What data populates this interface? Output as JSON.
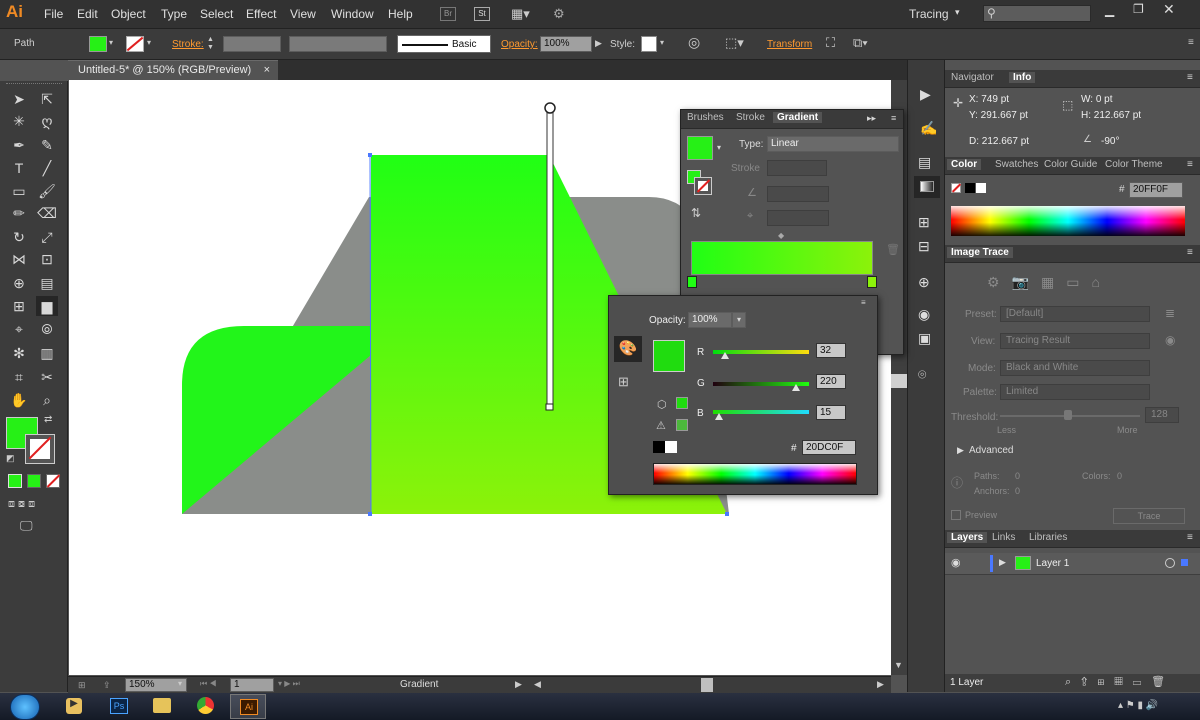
{
  "app": {
    "logo": "Ai"
  },
  "menu": [
    "File",
    "Edit",
    "Object",
    "Type",
    "Select",
    "Effect",
    "View",
    "Window",
    "Help"
  ],
  "menubar_right": {
    "br": "Br",
    "st": "St",
    "workspace": "Tracing",
    "search_placeholder": ""
  },
  "control": {
    "selection": "Path",
    "stroke_label": "Stroke:",
    "brush_label": "Basic",
    "opacity_label": "Opacity:",
    "opacity_value": "100%",
    "style_label": "Style:",
    "transform_label": "Transform"
  },
  "document": {
    "tab_title": "Untitled-5* @ 150% (RGB/Preview)",
    "close": "×"
  },
  "status": {
    "zoom": "150%",
    "page": "1",
    "info": "Gradient"
  },
  "navinfo": {
    "tabs": [
      "Navigator",
      "Info"
    ],
    "x": "X:  749 pt",
    "y": "Y:  291.667 pt",
    "w": "W:  0 pt",
    "h": "H:  212.667 pt",
    "d": "D:  212.667 pt",
    "angle": "-90°"
  },
  "color_panel": {
    "tabs": [
      "Color",
      "Swatches",
      "Color Guide",
      "Color Theme"
    ],
    "hex": "20FF0F"
  },
  "image_trace": {
    "title": "Image Trace",
    "preset_label": "Preset:",
    "preset_value": "[Default]",
    "view_label": "View:",
    "view_value": "Tracing Result",
    "mode_label": "Mode:",
    "mode_value": "Black and White",
    "palette_label": "Palette:",
    "palette_value": "Limited",
    "threshold_label": "Threshold:",
    "threshold_value": "128",
    "less": "Less",
    "more": "More",
    "advanced": "Advanced",
    "paths_label": "Paths:",
    "paths_value": "0",
    "colors_label": "Colors:",
    "colors_value": "0",
    "anchors_label": "Anchors:",
    "anchors_value": "0",
    "preview": "Preview",
    "trace": "Trace"
  },
  "layers": {
    "tabs": [
      "Layers",
      "Links",
      "Libraries"
    ],
    "layer_name": "Layer 1",
    "count": "1 Layer"
  },
  "gradient_panel": {
    "tabs": [
      "Brushes",
      "Stroke",
      "Gradient"
    ],
    "type_label": "Type:",
    "type_value": "Linear",
    "stroke_label": "Stroke"
  },
  "color_popup": {
    "opacity_label": "Opacity:",
    "opacity_value": "100%",
    "r_label": "R",
    "r_value": "32",
    "g_label": "G",
    "g_value": "220",
    "b_label": "B",
    "b_value": "15",
    "hex_label": "#",
    "hex_value": "20DC0F"
  },
  "colors": {
    "fill": "#26f016",
    "gray": "#8a8d8a",
    "accent": "#ff9a2f"
  }
}
